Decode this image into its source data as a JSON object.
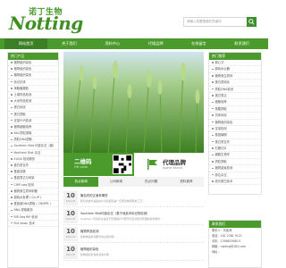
{
  "brand": {
    "cn": "诺丁生物",
    "en": "Notting"
  },
  "search": {
    "placeholder": "请输入您要搜索的关键词"
  },
  "nav": [
    "网站首页",
    "关于我们",
    "资料中心",
    "代理品牌",
    "在线留言",
    "联系我们"
  ],
  "left_panel": {
    "title": "热门产品",
    "items": [
      "植物组织染色",
      "植物组织染色",
      "植物组织染色",
      "标记抗体",
      "琼脂糖凝胶",
      "土壤样品检测",
      "大米样品检测",
      "蛋白纯化",
      "蛋白提取",
      "定量PCR检测",
      "植物细胞培养",
      "BAC质粒提取",
      "质粒DNA提取",
      "Southern Blot 印迹杂交（膜）",
      "Northern Blot 杂交",
      "ELISA 检测服务",
      "蛋白质互作",
      "基因克隆",
      "基因表达与转染",
      "CHIP-seq 检测",
      "植物原生质体制备",
      "超纯水处理 ( Co-IP )",
      "基因组DNA提取 ( CRISPR )",
      "RNA 提取服务",
      "RIP-Seq RIP 检测",
      "Pull down 技术"
    ]
  },
  "promo": {
    "left_title": "二维码",
    "left_sub": "QR code",
    "right_title": "代理品牌",
    "right_sub": "Agent Brand"
  },
  "tabs": [
    "热点新闻",
    "公司新闻",
    "热点问题",
    "资料推荐"
  ],
  "news": [
    {
      "day": "10",
      "month": "2021-07",
      "title": "膜包衣的正面有哪些",
      "desc": "膜包衣技术是指在片剂表面包裹一层聚合物薄膜的工艺..."
    },
    {
      "day": "10",
      "month": "2021-07",
      "title": "Southern Blot印迹杂交（基于地高辛标记的检测）",
      "desc": "Southern 印迹杂交是基于核酸探针与靶序列互补配对原理的检测技术..."
    },
    {
      "day": "10",
      "month": "2021-07",
      "title": "植物样品检测",
      "desc": "植物样品检测服务的主要内容..."
    },
    {
      "day": "10",
      "month": "2021-07",
      "title": "植物组织染色",
      "desc": "植物组织染色的基本步骤..."
    }
  ],
  "right_panel": {
    "title": "热门推荐",
    "items": [
      "离心式",
      "超纯水仪器",
      "植物原生质体",
      "蛋白质纯化",
      "质粒DNA检测",
      "蛋白表达",
      "细胞培养",
      "核酸提取",
      "抗体纯化",
      "植物组织染色",
      "定量检测",
      "基因编辑",
      "蛋白质互作",
      "石蜡切片",
      "细胞生物学",
      "质粒提取",
      "植物激素检测",
      "原位杂交",
      "荧光蛋白技术"
    ]
  },
  "contact": {
    "title": "联系我们",
    "lines": [
      "联系人：刘老师",
      "电话：181 2381 9121",
      "手机：13568290813",
      "邮箱：notting@163.com",
      "地址："
    ]
  },
  "colors": {
    "primary": "#4a9a2c",
    "primary_dark": "#3b8024",
    "banner_sky": "#c7dfe9",
    "banner_field": "#5b9a32"
  }
}
